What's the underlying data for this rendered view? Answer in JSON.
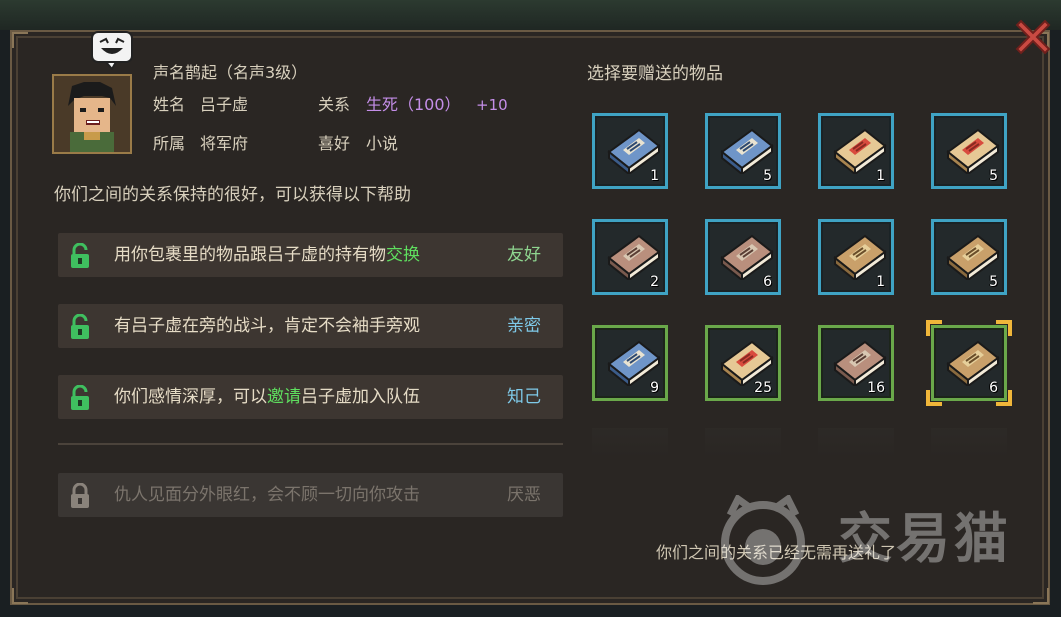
{
  "character": {
    "reputation": "声名鹊起（名声3级）",
    "name_label": "姓名",
    "name": "吕子虚",
    "relation_label": "关系",
    "relation_status": "生死（100）",
    "relation_bonus": "+10",
    "faction_label": "所属",
    "faction": "将军府",
    "hobby_label": "喜好",
    "hobby": "小说"
  },
  "help_intro": "你们之间的关系保持的很好，可以获得以下帮助",
  "benefits": [
    {
      "pre": "用你包裹里的物品跟吕子虚的持有物",
      "highlight": "交换",
      "post": "",
      "level": "友好",
      "unlocked": true
    },
    {
      "pre": "有吕子虚在旁的战斗，肯定不会袖手旁观",
      "highlight": "",
      "post": "",
      "level": "亲密",
      "unlocked": true
    },
    {
      "pre": "你们感情深厚，可以",
      "highlight": "邀请",
      "post": "吕子虚加入队伍",
      "level": "知己",
      "unlocked": true
    },
    {
      "pre": "仇人见面分外眼红，会不顾一切向你攻击",
      "highlight": "",
      "post": "",
      "level": "厌恶",
      "unlocked": false
    }
  ],
  "gift_title": "选择要赠送的物品",
  "gift_items": [
    {
      "book": "blue-book",
      "border": "blue",
      "count": "1"
    },
    {
      "book": "blue-book",
      "border": "blue",
      "count": "5"
    },
    {
      "book": "red-book",
      "border": "blue",
      "count": "1"
    },
    {
      "book": "red-book",
      "border": "blue",
      "count": "5"
    },
    {
      "book": "brown-book",
      "border": "blue",
      "count": "2"
    },
    {
      "book": "brown-book",
      "border": "blue",
      "count": "6"
    },
    {
      "book": "tan-book",
      "border": "blue",
      "count": "1"
    },
    {
      "book": "tan-book",
      "border": "blue",
      "count": "5"
    },
    {
      "book": "blue-book",
      "border": "green",
      "count": "9"
    },
    {
      "book": "red-book",
      "border": "green",
      "count": "25"
    },
    {
      "book": "brown-book",
      "border": "green",
      "count": "16"
    },
    {
      "book": "tan-book",
      "border": "green",
      "count": "6",
      "selected": true
    }
  ],
  "footer_note": "你们之间的关系已经无需再送礼了",
  "watermark": "交易猫",
  "colors": {
    "highlight_green": "#5fdf5f",
    "relation_purple": "#c48ee8",
    "border_blue": "#3fa3c4",
    "border_green": "#6aa84a",
    "select_gold": "#f0b63a"
  }
}
